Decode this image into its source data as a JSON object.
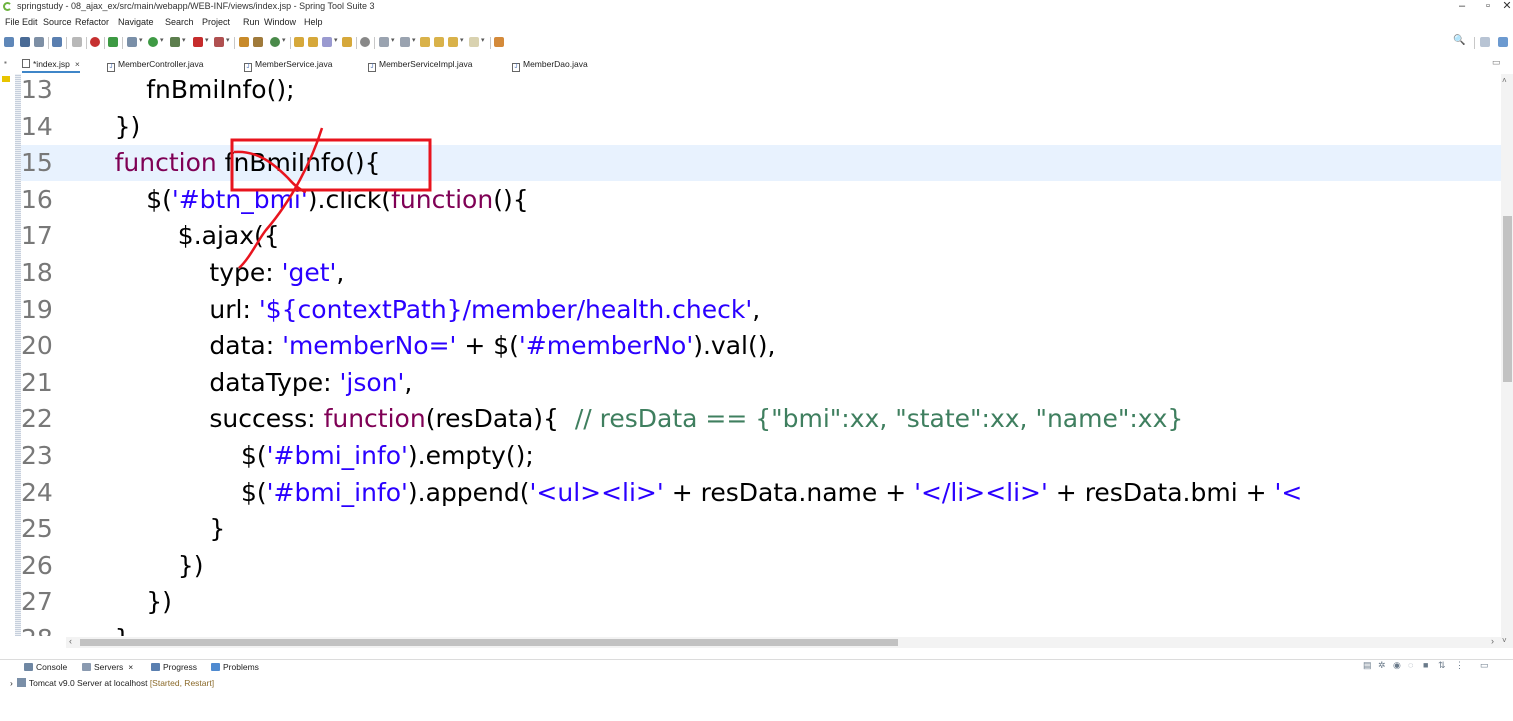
{
  "window": {
    "title": "springstudy - 08_ajax_ex/src/main/webapp/WEB-INF/views/index.jsp - Spring Tool Suite 3",
    "minimize": "–",
    "maximize": "▫",
    "close": "✕"
  },
  "menu": [
    "File",
    "Edit",
    "Source",
    "Refactor",
    "Navigate",
    "Search",
    "Project",
    "Run",
    "Window",
    "Help"
  ],
  "toolbar": {
    "search_icon": "🔍"
  },
  "tabs": [
    {
      "label": "*index.jsp",
      "active": true
    },
    {
      "label": "MemberController.java"
    },
    {
      "label": "MemberService.java"
    },
    {
      "label": "MemberServiceImpl.java"
    },
    {
      "label": "MemberDao.java"
    }
  ],
  "editor": {
    "current_line": 15,
    "lines": [
      {
        "n": "13",
        "indent": "    ",
        "tokens": [
          {
            "t": "fnBmiInfo();",
            "c": ""
          }
        ]
      },
      {
        "n": "14",
        "indent": "  ",
        "tokens": [
          {
            "t": "})",
            "c": ""
          }
        ]
      },
      {
        "n": "15",
        "indent": "  ",
        "tokens": [
          {
            "t": "function",
            "c": "kw"
          },
          {
            "t": " fnBmiInfo(){",
            "c": ""
          }
        ]
      },
      {
        "n": "16",
        "indent": "    ",
        "tokens": [
          {
            "t": "$(",
            "c": ""
          },
          {
            "t": "'#btn_bmi'",
            "c": "str"
          },
          {
            "t": ").click(",
            "c": ""
          },
          {
            "t": "function",
            "c": "kw"
          },
          {
            "t": "(){",
            "c": ""
          }
        ]
      },
      {
        "n": "17",
        "indent": "      ",
        "tokens": [
          {
            "t": "$.ajax({",
            "c": ""
          }
        ]
      },
      {
        "n": "18",
        "indent": "        ",
        "tokens": [
          {
            "t": "type: ",
            "c": ""
          },
          {
            "t": "'get'",
            "c": "str"
          },
          {
            "t": ",",
            "c": ""
          }
        ]
      },
      {
        "n": "19",
        "indent": "        ",
        "tokens": [
          {
            "t": "url: ",
            "c": ""
          },
          {
            "t": "'${contextPath}/member/health.check'",
            "c": "str"
          },
          {
            "t": ",",
            "c": ""
          }
        ]
      },
      {
        "n": "20",
        "indent": "        ",
        "tokens": [
          {
            "t": "data: ",
            "c": ""
          },
          {
            "t": "'memberNo='",
            "c": "str"
          },
          {
            "t": " + $(",
            "c": ""
          },
          {
            "t": "'#memberNo'",
            "c": "str"
          },
          {
            "t": ").val(),",
            "c": ""
          }
        ]
      },
      {
        "n": "21",
        "indent": "        ",
        "tokens": [
          {
            "t": "dataType: ",
            "c": ""
          },
          {
            "t": "'json'",
            "c": "str"
          },
          {
            "t": ",",
            "c": ""
          }
        ]
      },
      {
        "n": "22",
        "indent": "        ",
        "tokens": [
          {
            "t": "success: ",
            "c": ""
          },
          {
            "t": "function",
            "c": "kw"
          },
          {
            "t": "(resData){  ",
            "c": ""
          },
          {
            "t": "// resData == {\"bmi\":xx, \"state\":xx, \"name\":xx}",
            "c": "cmt"
          }
        ]
      },
      {
        "n": "23",
        "indent": "          ",
        "tokens": [
          {
            "t": "$(",
            "c": ""
          },
          {
            "t": "'#bmi_info'",
            "c": "str"
          },
          {
            "t": ").empty();",
            "c": ""
          }
        ]
      },
      {
        "n": "24",
        "indent": "          ",
        "tokens": [
          {
            "t": "$(",
            "c": ""
          },
          {
            "t": "'#bmi_info'",
            "c": "str"
          },
          {
            "t": ").append(",
            "c": ""
          },
          {
            "t": "'<ul><li>'",
            "c": "str"
          },
          {
            "t": " + resData.name + ",
            "c": ""
          },
          {
            "t": "'</li><li>'",
            "c": "str"
          },
          {
            "t": " + resData.bmi + ",
            "c": ""
          },
          {
            "t": "'<",
            "c": "str"
          }
        ]
      },
      {
        "n": "25",
        "indent": "        ",
        "tokens": [
          {
            "t": "}",
            "c": ""
          }
        ]
      },
      {
        "n": "26",
        "indent": "      ",
        "tokens": [
          {
            "t": "})",
            "c": ""
          }
        ]
      },
      {
        "n": "27",
        "indent": "    ",
        "tokens": [
          {
            "t": "})",
            "c": ""
          }
        ]
      },
      {
        "n": "28",
        "indent": "  ",
        "tokens": [
          {
            "t": "}",
            "c": ""
          }
        ]
      }
    ]
  },
  "bottom_tabs": [
    {
      "label": "Console"
    },
    {
      "label": "Servers",
      "active": true
    },
    {
      "label": "Progress"
    },
    {
      "label": "Problems"
    }
  ],
  "servers": {
    "name": "Tomcat v9.0 Server at localhost",
    "state": "[Started, Restart]"
  },
  "colors": {
    "keyword": "#7f0055",
    "string": "#2a00ff",
    "comment": "#3f7f5f",
    "current_line_bg": "#e8f2fe",
    "annotation": "#e8141e"
  }
}
